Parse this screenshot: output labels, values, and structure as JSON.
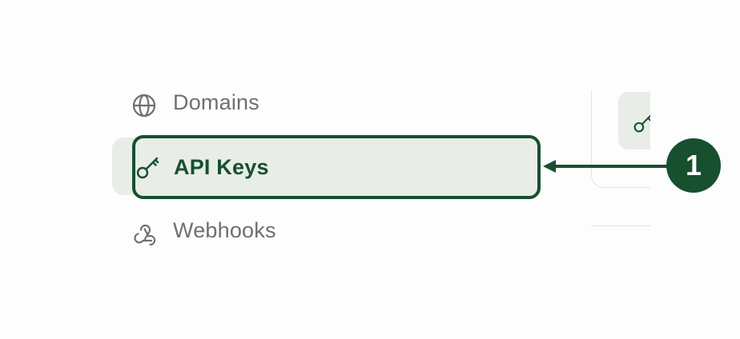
{
  "nav": {
    "items": [
      {
        "label": "Domains",
        "icon": "globe-icon"
      },
      {
        "label": "API Keys",
        "icon": "key-icon",
        "active": true
      },
      {
        "label": "Webhooks",
        "icon": "webhook-icon"
      }
    ]
  },
  "callout": {
    "number": "1"
  },
  "colors": {
    "accent": "#174f2f",
    "active_bg": "#e8ede8",
    "muted_text": "#6f6f73"
  }
}
